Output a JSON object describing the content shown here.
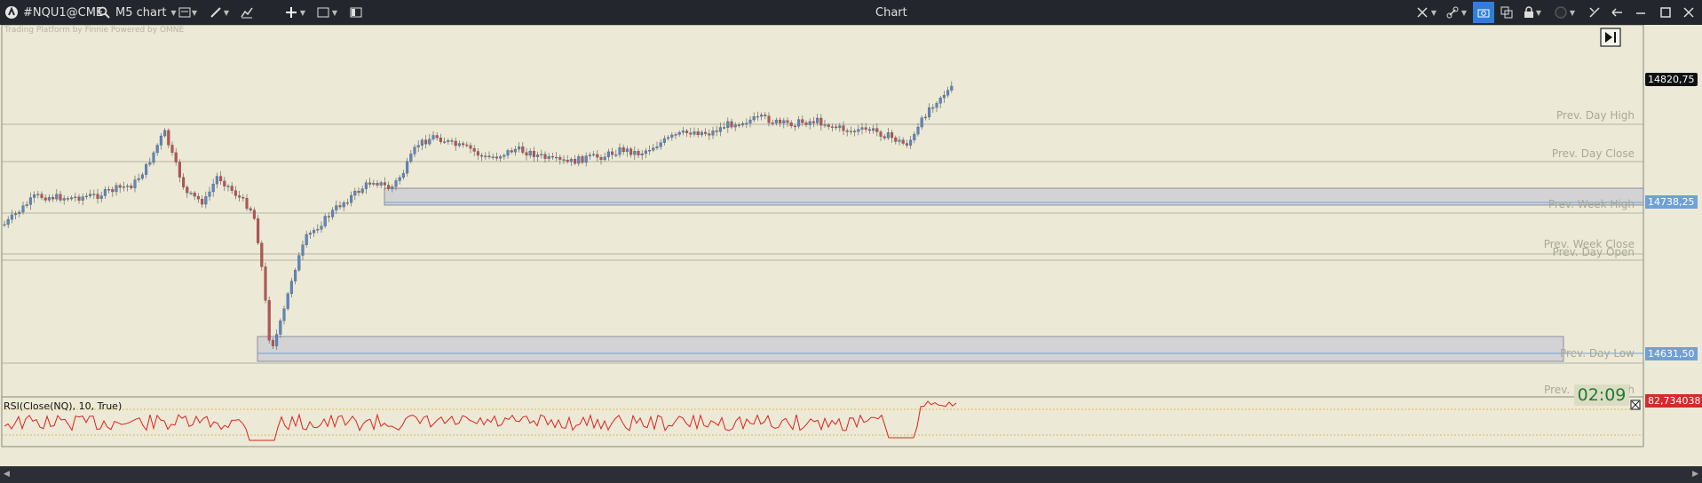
{
  "window": {
    "title": "Chart",
    "symbol": "#NQU1@CME",
    "timeframe": "M5 chart"
  },
  "watermark": "Trading Platform by Finnie  Powered by OMNE",
  "price_axis": {
    "last_price": "14820,75",
    "zone_high_price": "14738,25",
    "zone_low_price": "14631,50",
    "rsi_value": "82,7340381"
  },
  "levels": {
    "prev_day_high": "Prev. Day High",
    "prev_day_close": "Prev. Day Close",
    "prev_week_high": "Prev. Week High",
    "prev_week_close": "Prev. Week Close",
    "prev_day_open": "Prev. Day Open",
    "prev_day_low": "Prev. Day Low",
    "prev_month_high": "Prev. Month High"
  },
  "timer": "02:09",
  "indicator": {
    "label": "RSI(Close(NQ), 10, True)"
  },
  "colors": {
    "background": "#ecead6",
    "bull": "#5b86c7",
    "bear": "#c0504d",
    "rsi_line": "#e02020",
    "last_price_tag": "#111111",
    "zone_tag": "#6fa0d8",
    "rsi_tag": "#d42b2b",
    "timer_text": "#1f7a33"
  },
  "icons": [
    "app-logo-icon",
    "search-icon",
    "chart-type-icon",
    "draw-pen-icon",
    "indicator-icon",
    "crosshair-plus-icon",
    "template-icon",
    "layout-icon",
    "link-icon",
    "camera-icon",
    "clone-icon",
    "lock-icon",
    "color-circle-icon",
    "settings-icon",
    "scroll-end-icon",
    "minimize-icon",
    "maximize-icon",
    "close-icon"
  ]
}
